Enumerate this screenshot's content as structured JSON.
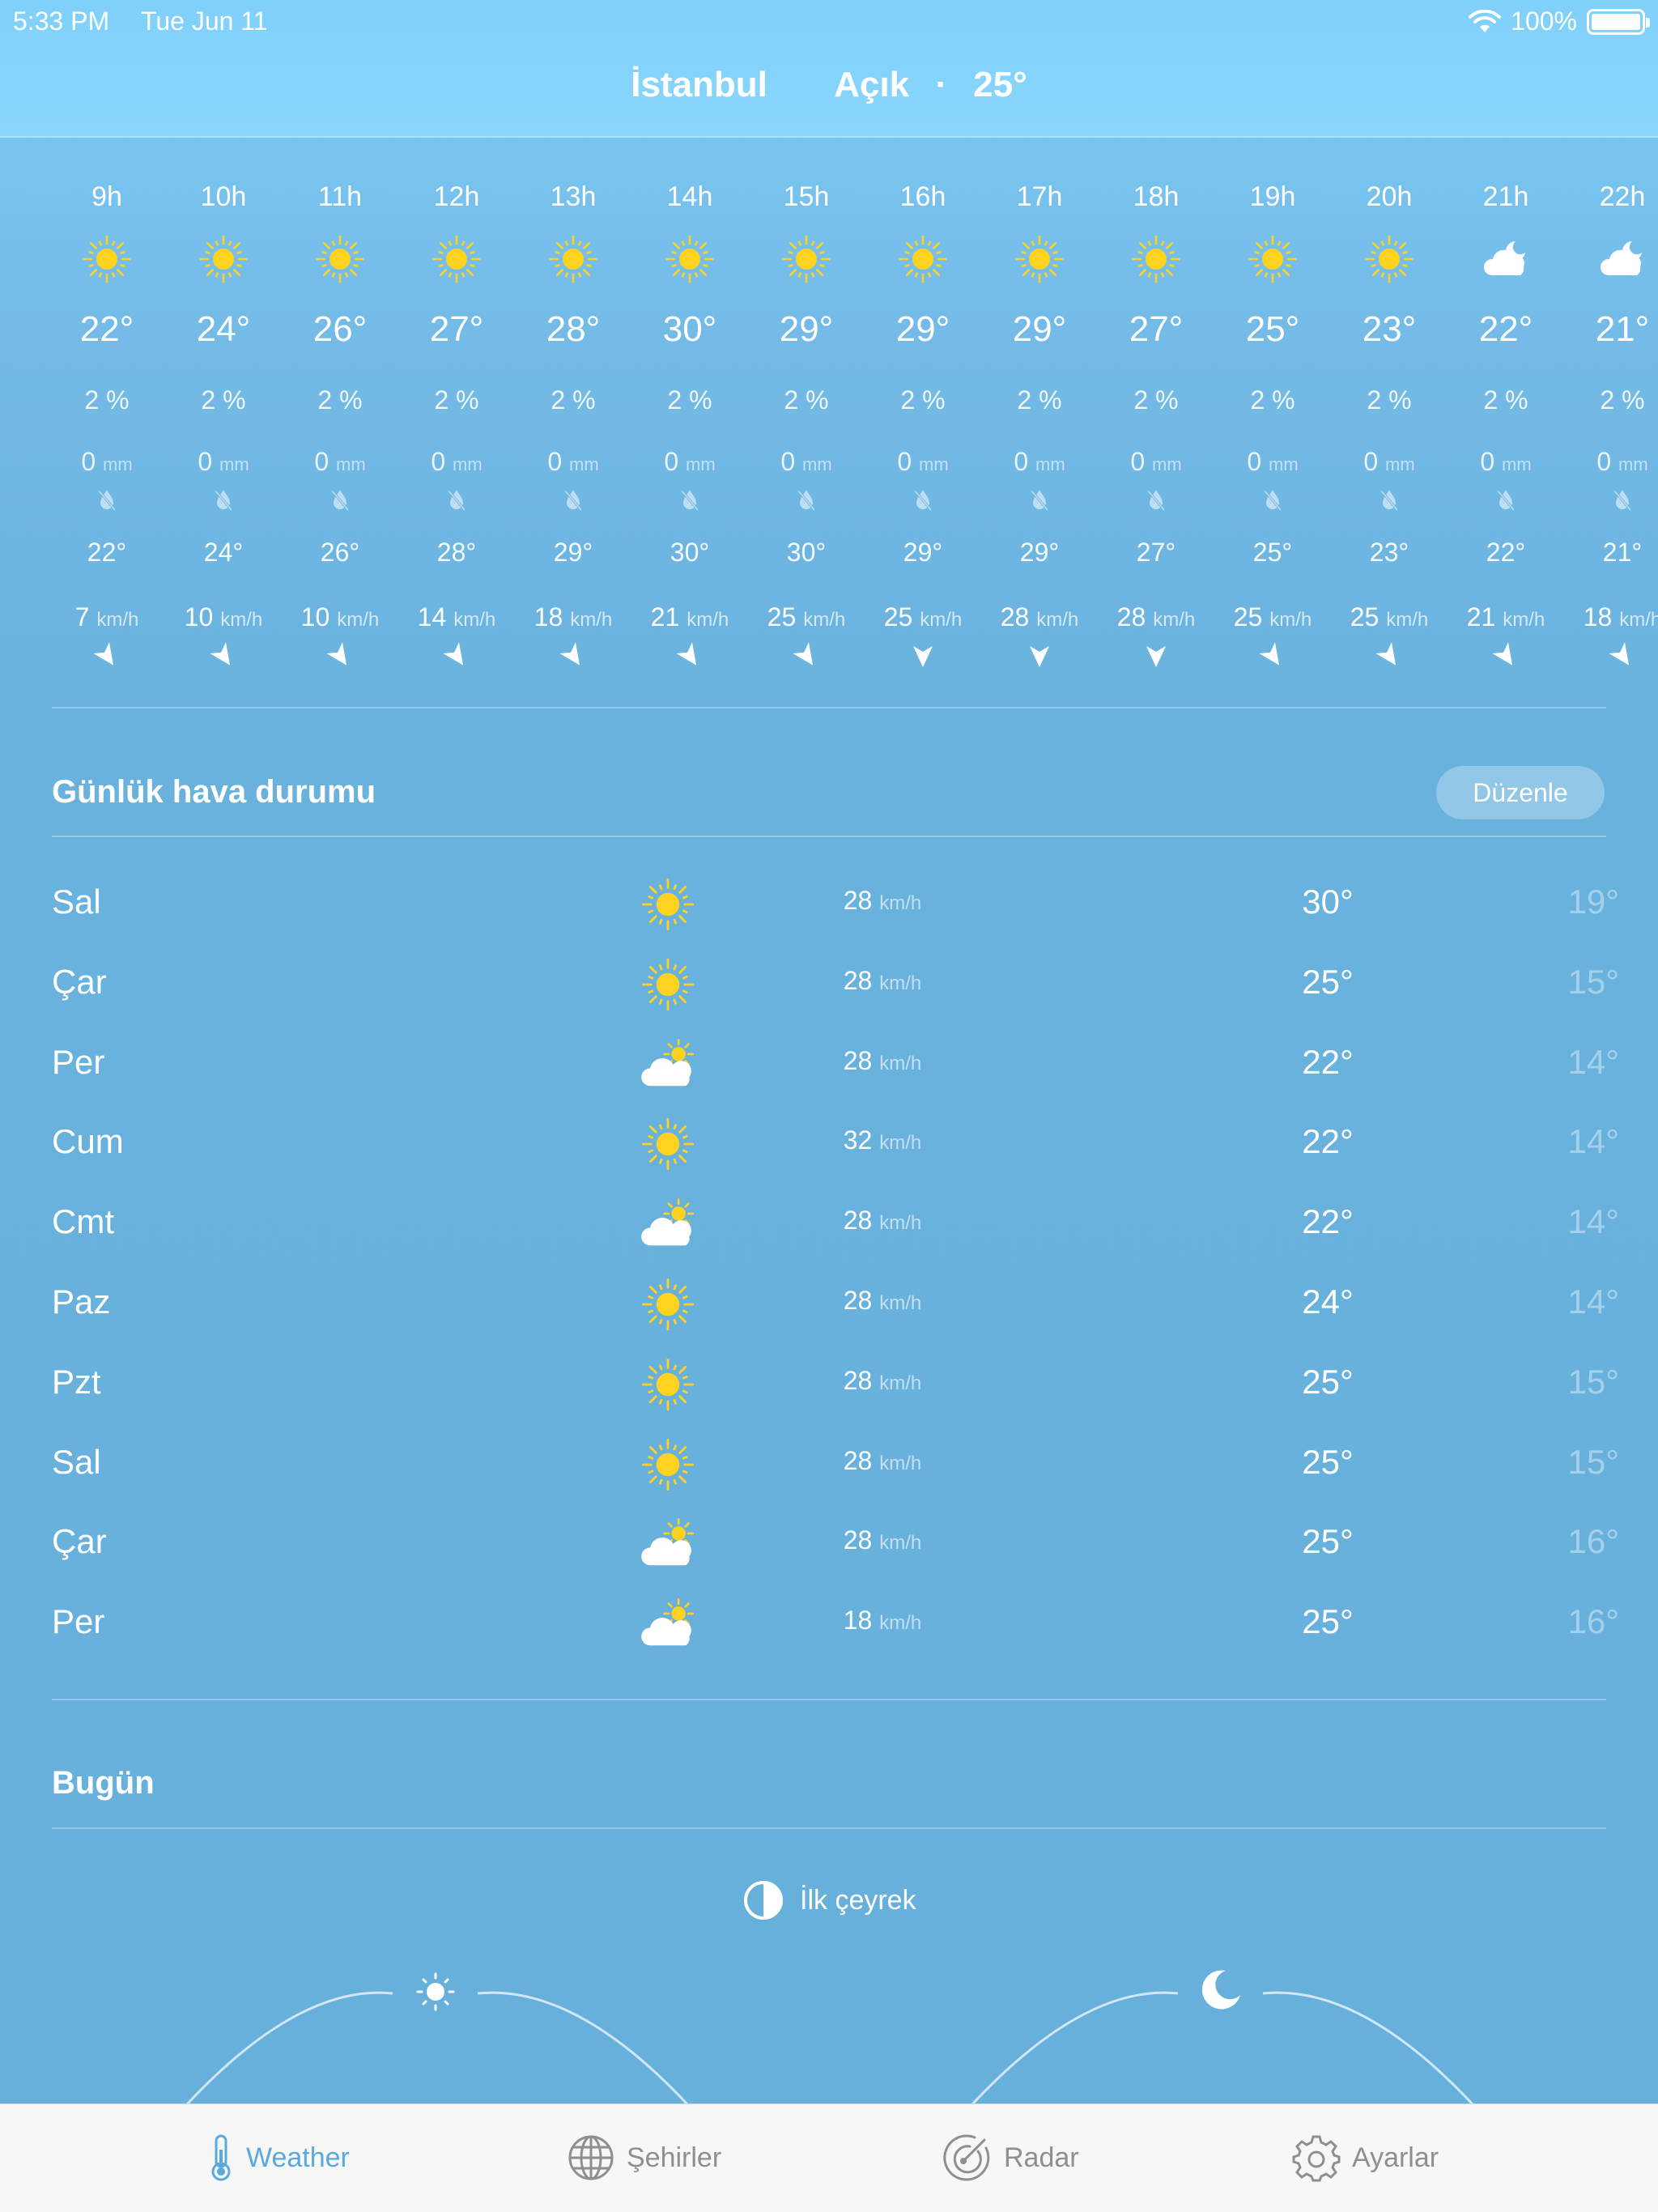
{
  "status_bar": {
    "time": "5:33 PM",
    "date": "Tue Jun 11",
    "battery": "100%"
  },
  "header": {
    "city": "İstanbul",
    "condition": "Açık",
    "separator": "·",
    "temp": "25°"
  },
  "hourly": [
    {
      "hour": "9h",
      "icon": "sun-icon",
      "temp": "22°",
      "prob": "2 %",
      "mm": "0",
      "feels": "22°",
      "wind": "7",
      "dir": "ne"
    },
    {
      "hour": "10h",
      "icon": "sun-icon",
      "temp": "24°",
      "prob": "2 %",
      "mm": "0",
      "feels": "24°",
      "wind": "10",
      "dir": "ne"
    },
    {
      "hour": "11h",
      "icon": "sun-icon",
      "temp": "26°",
      "prob": "2 %",
      "mm": "0",
      "feels": "26°",
      "wind": "10",
      "dir": "ne"
    },
    {
      "hour": "12h",
      "icon": "sun-icon",
      "temp": "27°",
      "prob": "2 %",
      "mm": "0",
      "feels": "28°",
      "wind": "14",
      "dir": "ne"
    },
    {
      "hour": "13h",
      "icon": "sun-icon",
      "temp": "28°",
      "prob": "2 %",
      "mm": "0",
      "feels": "29°",
      "wind": "18",
      "dir": "ne"
    },
    {
      "hour": "14h",
      "icon": "sun-icon",
      "temp": "30°",
      "prob": "2 %",
      "mm": "0",
      "feels": "30°",
      "wind": "21",
      "dir": "ne"
    },
    {
      "hour": "15h",
      "icon": "sun-icon",
      "temp": "29°",
      "prob": "2 %",
      "mm": "0",
      "feels": "30°",
      "wind": "25",
      "dir": "ne"
    },
    {
      "hour": "16h",
      "icon": "sun-icon",
      "temp": "29°",
      "prob": "2 %",
      "mm": "0",
      "feels": "29°",
      "wind": "25",
      "dir": "s"
    },
    {
      "hour": "17h",
      "icon": "sun-icon",
      "temp": "29°",
      "prob": "2 %",
      "mm": "0",
      "feels": "29°",
      "wind": "28",
      "dir": "s"
    },
    {
      "hour": "18h",
      "icon": "sun-icon",
      "temp": "27°",
      "prob": "2 %",
      "mm": "0",
      "feels": "27°",
      "wind": "28",
      "dir": "s"
    },
    {
      "hour": "19h",
      "icon": "sun-icon",
      "temp": "25°",
      "prob": "2 %",
      "mm": "0",
      "feels": "25°",
      "wind": "25",
      "dir": "ne"
    },
    {
      "hour": "20h",
      "icon": "sun-icon",
      "temp": "23°",
      "prob": "2 %",
      "mm": "0",
      "feels": "23°",
      "wind": "25",
      "dir": "ne"
    },
    {
      "hour": "21h",
      "icon": "moon-cloud-icon",
      "temp": "22°",
      "prob": "2 %",
      "mm": "0",
      "feels": "22°",
      "wind": "21",
      "dir": "ne"
    },
    {
      "hour": "22h",
      "icon": "moon-cloud-icon",
      "temp": "21°",
      "prob": "2 %",
      "mm": "0",
      "feels": "21°",
      "wind": "18",
      "dir": "ne"
    }
  ],
  "units": {
    "mm": "mm",
    "wind": "km/h"
  },
  "daily_section": {
    "title": "Günlük hava durumu",
    "edit_label": "Düzenle"
  },
  "daily": [
    {
      "day": "Sal",
      "icon": "sun-icon",
      "wind": "28",
      "high": "30°",
      "low": "19°"
    },
    {
      "day": "Çar",
      "icon": "sun-icon",
      "wind": "28",
      "high": "25°",
      "low": "15°"
    },
    {
      "day": "Per",
      "icon": "sun-cloud-icon",
      "wind": "28",
      "high": "22°",
      "low": "14°"
    },
    {
      "day": "Cum",
      "icon": "sun-icon",
      "wind": "32",
      "high": "22°",
      "low": "14°"
    },
    {
      "day": "Cmt",
      "icon": "sun-cloud-icon",
      "wind": "28",
      "high": "22°",
      "low": "14°"
    },
    {
      "day": "Paz",
      "icon": "sun-icon",
      "wind": "28",
      "high": "24°",
      "low": "14°"
    },
    {
      "day": "Pzt",
      "icon": "sun-icon",
      "wind": "28",
      "high": "25°",
      "low": "15°"
    },
    {
      "day": "Sal",
      "icon": "sun-icon",
      "wind": "28",
      "high": "25°",
      "low": "15°"
    },
    {
      "day": "Çar",
      "icon": "sun-cloud-icon",
      "wind": "28",
      "high": "25°",
      "low": "16°"
    },
    {
      "day": "Per",
      "icon": "sun-cloud-icon",
      "wind": "18",
      "high": "25°",
      "low": "16°"
    }
  ],
  "today_section": {
    "title": "Bugün",
    "moon_phase": "İlk çeyrek"
  },
  "tabs": [
    {
      "label": "Weather",
      "icon": "thermometer-icon",
      "active": true
    },
    {
      "label": "Şehirler",
      "icon": "globe-icon",
      "active": false
    },
    {
      "label": "Radar",
      "icon": "radar-icon",
      "active": false
    },
    {
      "label": "Ayarlar",
      "icon": "gear-icon",
      "active": false
    }
  ],
  "colors": {
    "sun": "#ffd21f",
    "accent": "#5aa9dd",
    "tab_inactive": "#8e8e93"
  }
}
